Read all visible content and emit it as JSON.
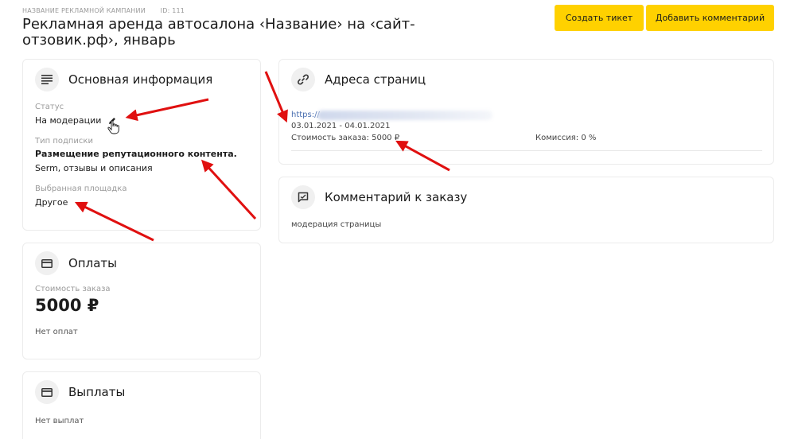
{
  "header": {
    "campaign_label": "НАЗВАНИЕ РЕКЛАМНОЙ КАМПАНИИ",
    "id_label": "ID: 111",
    "title": "Рекламная аренда автосалона ‹Название› на ‹сайт-отзовик.рф›, январь",
    "create_ticket_label": "Создать тикет",
    "add_comment_label": "Добавить комментарий"
  },
  "info": {
    "title": "Основная информация",
    "icon": "lines-icon",
    "status_label": "Статус",
    "status_value": "На модерации",
    "subscription_label": "Тип подписки",
    "subscription_value": "Размещение репутационного контента.",
    "subscription_desc": "Serm, отзывы и описания",
    "platform_label": "Выбранная площадка",
    "platform_value": "Другое"
  },
  "payments": {
    "title": "Оплаты",
    "icon": "card-icon",
    "cost_label": "Стоимость заказа",
    "cost_value": "5000 ₽",
    "empty_text": "Нет оплат"
  },
  "payouts": {
    "title": "Выплаты",
    "icon": "card-icon",
    "empty_text": "Нет выплат"
  },
  "urls": {
    "title": "Адреса страниц",
    "icon": "link-icon",
    "url_prefix": "https://",
    "dates": "03.01.2021 - 04.01.2021",
    "cost_text": "Стоимость заказа: 5000 ₽",
    "commission_text": "Комиссия: 0 %"
  },
  "comment": {
    "title": "Комментарий к заказу",
    "icon": "comment-icon",
    "text": "модерация страницы"
  },
  "colors": {
    "accent": "#ffd100",
    "arrow": "#e01010",
    "link": "#4a6fb0"
  }
}
